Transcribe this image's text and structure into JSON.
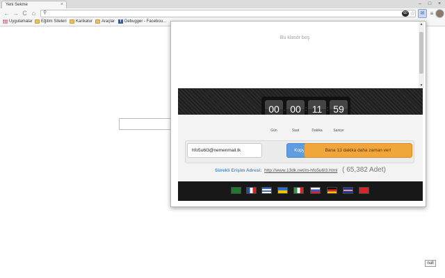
{
  "browser": {
    "tab_title": "Yeni Sekme",
    "tab_close": "×",
    "window_buttons": [
      "–",
      "□",
      "×"
    ],
    "nav": {
      "back": "←",
      "forward": "→",
      "reload": "C",
      "home": "⌂"
    },
    "omnibox_value": "",
    "search_glyph": "⚲",
    "star_glyph": "☆",
    "ext_badge_label": "60",
    "ext_active_glyph": "✉",
    "menu_glyph": "≡"
  },
  "bookmarks": [
    {
      "label": "Uygulamalar",
      "icon": "apps-icon"
    },
    {
      "label": "Eğitim Siteleri",
      "icon": "folder-icon"
    },
    {
      "label": "Karikatur",
      "icon": "folder-icon"
    },
    {
      "label": "Araçlar",
      "icon": "folder-icon"
    },
    {
      "label": "Debugger - Facebou...",
      "icon": "facebook-icon"
    }
  ],
  "popup": {
    "empty_message": "Bu klasör boş",
    "timer": {
      "days": "00",
      "hours": "00",
      "minutes": "11",
      "seconds": "59",
      "labels": {
        "days": "Gün",
        "hours": "Saat",
        "minutes": "Dakika",
        "seconds": "Saniye"
      }
    },
    "email_value": "hfo5u6l3@nemenmail.tk",
    "copy_label": "Kopyala",
    "extend_label": "Bana 13 dakika daha zaman ver!",
    "access_label": "Sürekli Erişim Adresi:",
    "access_link": "http://www.13dk.net/m-hfo5u6l3.html",
    "count_text": "( 65,382 Adet)",
    "flags": [
      {
        "icon": "saudi-flag-icon",
        "color": "#1c7a2e"
      },
      {
        "icon": "france-flag-icon",
        "color": "#ffffff"
      },
      {
        "icon": "greece-flag-icon",
        "color": "#3a6fc4"
      },
      {
        "icon": "ukraine-flag-icon",
        "color": "#f2c400"
      },
      {
        "icon": "italy-flag-icon",
        "color": "#2e9a45"
      },
      {
        "icon": "russia-flag-icon",
        "color": "#ffffff"
      },
      {
        "icon": "germany-flag-icon",
        "color": "#111111"
      },
      {
        "icon": "uk-flag-icon",
        "color": "#1f3a8a"
      },
      {
        "icon": "turkey-flag-icon",
        "color": "#d8232a"
      }
    ]
  },
  "page": {
    "null_badge": "null"
  }
}
